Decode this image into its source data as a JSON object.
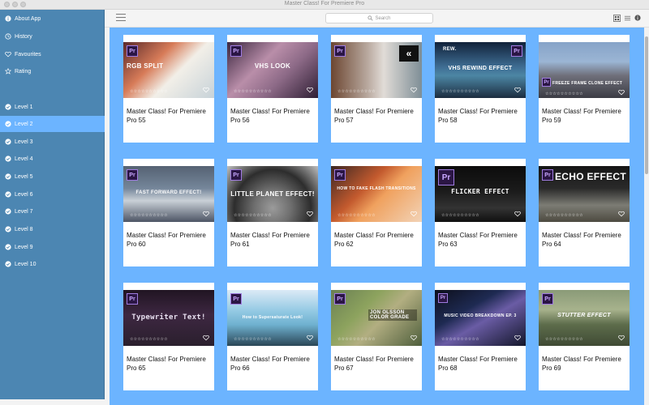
{
  "window": {
    "title": "Master Class! For Premiere Pro"
  },
  "sidebar": {
    "items": [
      {
        "label": "About App",
        "icon": "info-icon",
        "active": false
      },
      {
        "label": "History",
        "icon": "clock-icon",
        "active": false
      },
      {
        "label": "Favourites",
        "icon": "heart-icon",
        "active": false
      },
      {
        "label": "Rating",
        "icon": "star-icon",
        "active": false
      },
      {
        "label": "Level 1",
        "icon": "check-circle-icon",
        "active": false
      },
      {
        "label": "Level 2",
        "icon": "check-circle-icon",
        "active": true
      },
      {
        "label": "Level 3",
        "icon": "check-circle-icon",
        "active": false
      },
      {
        "label": "Level 4",
        "icon": "check-circle-icon",
        "active": false
      },
      {
        "label": "Level 5",
        "icon": "check-circle-icon",
        "active": false
      },
      {
        "label": "Level 6",
        "icon": "check-circle-icon",
        "active": false
      },
      {
        "label": "Level 7",
        "icon": "check-circle-icon",
        "active": false
      },
      {
        "label": "Level 8",
        "icon": "check-circle-icon",
        "active": false
      },
      {
        "label": "Level 9",
        "icon": "check-circle-icon",
        "active": false
      },
      {
        "label": "Level 10",
        "icon": "check-circle-icon",
        "active": false
      }
    ]
  },
  "toolbar": {
    "search_placeholder": "Search",
    "icons": [
      "hamburger-menu-icon",
      "search-icon",
      "grid-view-icon",
      "list-view-icon",
      "info-icon"
    ]
  },
  "colors": {
    "sidebar_bg": "#4c86b2",
    "active_item_bg": "#6cb4ff",
    "content_bg": "#6cb4ff",
    "card_bg": "#ffffff"
  },
  "cards": [
    {
      "title": "Master Class! For Premiere Pro 55",
      "thumb_text": "RGB SPLIT",
      "rating_stars": "☆☆☆☆☆☆☆☆☆☆"
    },
    {
      "title": "Master Class! For Premiere Pro 56",
      "thumb_text": "VHS LOOK",
      "rating_stars": "☆☆☆☆☆☆☆☆☆☆"
    },
    {
      "title": "Master Class! For Premiere Pro 57",
      "thumb_text": "",
      "rating_stars": "☆☆☆☆☆☆☆☆☆☆"
    },
    {
      "title": "Master Class! For Premiere Pro 58",
      "thumb_text": "VHS REWIND EFFECT",
      "rating_stars": "☆☆☆☆☆☆☆☆☆☆"
    },
    {
      "title": "Master Class! For Premiere Pro 59",
      "thumb_text": "FREEZE FRAME CLONE EFFECT",
      "rating_stars": "☆☆☆☆☆☆☆☆☆☆"
    },
    {
      "title": "Master Class! For Premiere Pro 60",
      "thumb_text": "FAST FORWARD EFFECT!",
      "rating_stars": "☆☆☆☆☆☆☆☆☆☆"
    },
    {
      "title": "Master Class! For Premiere Pro 61",
      "thumb_text": "LITTLE PLANET EFFECT!",
      "rating_stars": "☆☆☆☆☆☆☆☆☆☆"
    },
    {
      "title": "Master Class! For Premiere Pro 62",
      "thumb_text": "HOW TO FAKE FLASH TRANSITIONS",
      "rating_stars": "☆☆☆☆☆☆☆☆☆☆"
    },
    {
      "title": "Master Class! For Premiere Pro 63",
      "thumb_text": "FLICKER EFFECT",
      "rating_stars": "☆☆☆☆☆☆☆☆☆☆"
    },
    {
      "title": "Master Class! For Premiere Pro 64",
      "thumb_text": "ECHO EFFECT",
      "rating_stars": "☆☆☆☆☆☆☆☆☆☆"
    },
    {
      "title": "Master Class! For Premiere Pro 65",
      "thumb_text": "Typewriter Text!",
      "rating_stars": "☆☆☆☆☆☆☆☆☆☆"
    },
    {
      "title": "Master Class! For Premiere Pro 66",
      "thumb_text": "How to Supersaturate Look!",
      "rating_stars": "☆☆☆☆☆☆☆☆☆☆"
    },
    {
      "title": "Master Class! For Premiere Pro 67",
      "thumb_text": "JON OLSSON COLOR GRADE",
      "rating_stars": "☆☆☆☆☆☆☆☆☆☆"
    },
    {
      "title": "Master Class! For Premiere Pro 68",
      "thumb_text": "MUSIC VIDEO BREAKDOWN EP. 3",
      "rating_stars": "☆☆☆☆☆☆☆☆☆☆"
    },
    {
      "title": "Master Class! For Premiere Pro 69",
      "thumb_text": "STUTTER EFFECT",
      "rating_stars": "☆☆☆☆☆☆☆☆☆☆"
    }
  ]
}
